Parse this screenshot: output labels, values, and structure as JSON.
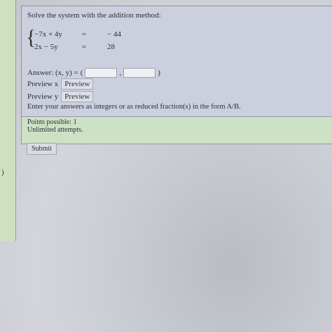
{
  "left_margin_text": ")",
  "question": {
    "prompt": "Solve the system with the addition method:",
    "equations": [
      {
        "lhs": "−7x + 4y",
        "op": "=",
        "rhs": "− 44"
      },
      {
        "lhs": "2x − 5y",
        "op": "=",
        "rhs": "28"
      }
    ],
    "answer_label": "Answer: (x, y) =",
    "answer_open": "(",
    "answer_comma": ",",
    "answer_close": ")",
    "answer_x_value": "",
    "answer_y_value": "",
    "preview_x_label": "Preview x",
    "preview_y_label": "Preview y",
    "preview_button": "Preview",
    "instructions": "Enter your answers as integers or as reduced fraction(s) in the form A/B."
  },
  "points": {
    "possible": "Points possible: 1",
    "attempts": "Unlimited attempts."
  },
  "submit_label": "Submit"
}
